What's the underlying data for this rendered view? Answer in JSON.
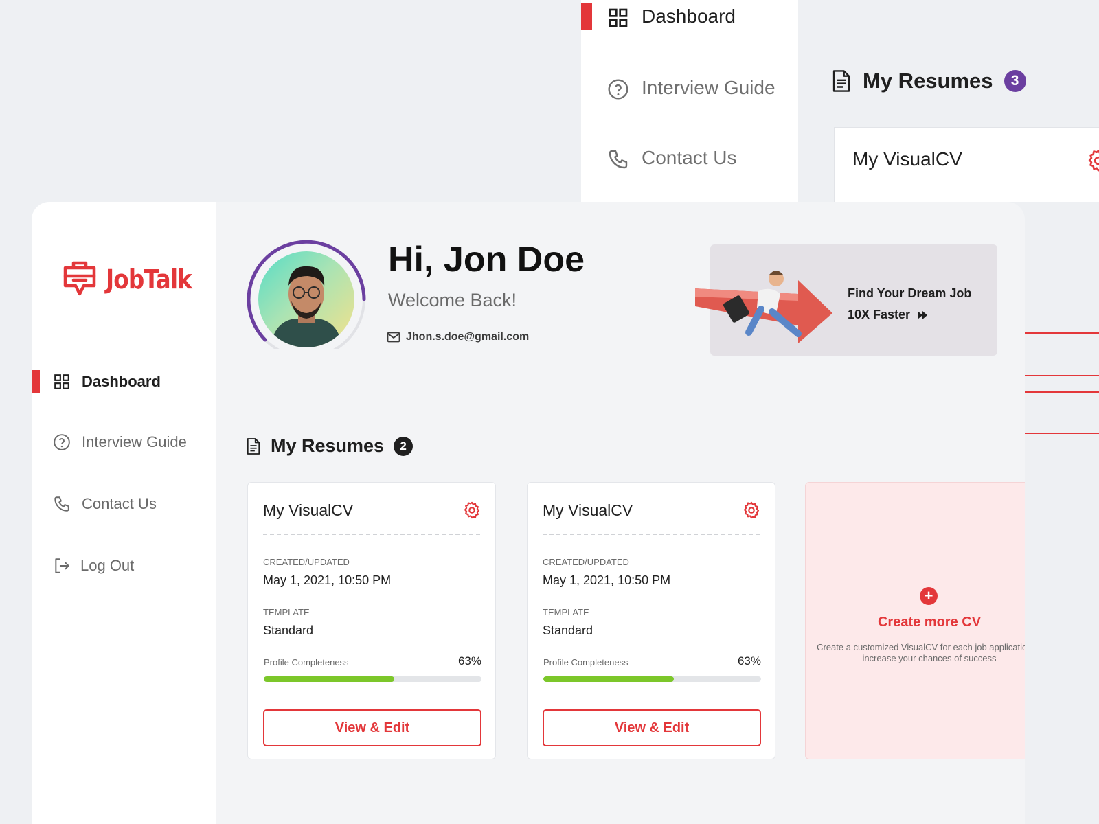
{
  "background_preview": {
    "nav": [
      {
        "label": "Dashboard",
        "icon": "grid-icon",
        "active": true
      },
      {
        "label": "Interview Guide",
        "icon": "question-circle-icon",
        "active": false
      },
      {
        "label": "Contact Us",
        "icon": "phone-icon",
        "active": false
      }
    ],
    "heading": "My Resumes",
    "count": "3",
    "card_title": "My VisualCV"
  },
  "brand": {
    "name": "JobTalk",
    "accent": "#e3373a"
  },
  "sidebar": {
    "items": [
      {
        "label": "Dashboard",
        "icon": "grid-icon",
        "active": true
      },
      {
        "label": "Interview Guide",
        "icon": "question-circle-icon",
        "active": false
      },
      {
        "label": "Contact Us",
        "icon": "phone-icon",
        "active": false
      },
      {
        "label": "Log Out",
        "icon": "logout-icon",
        "active": false
      }
    ]
  },
  "profile": {
    "greeting": "Hi, Jon Doe",
    "welcome": "Welcome Back!",
    "email": "Jhon.s.doe@gmail.com"
  },
  "promo": {
    "line1": "Find Your Dream Job",
    "line2": "10X Faster"
  },
  "resumes": {
    "heading": "My Resumes",
    "count": "2",
    "cards": [
      {
        "title": "My VisualCV",
        "created_label": "CREATED/UPDATED",
        "created_value": "May 1, 2021, 10:50 PM",
        "template_label": "TEMPLATE",
        "template_value": "Standard",
        "completeness_label": "Profile Completeness",
        "completeness_value": "63%",
        "completeness_fraction": 0.6,
        "button_label": "View & Edit"
      },
      {
        "title": "My VisualCV",
        "created_label": "CREATED/UPDATED",
        "created_value": "May 1, 2021, 10:50 PM",
        "template_label": "TEMPLATE",
        "template_value": "Standard",
        "completeness_label": "Profile Completeness",
        "completeness_value": "63%",
        "completeness_fraction": 0.6,
        "button_label": "View & Edit"
      }
    ],
    "create": {
      "title": "Create more CV",
      "description": "Create a customized VisualCV for each job application to increase your chances of success"
    }
  }
}
